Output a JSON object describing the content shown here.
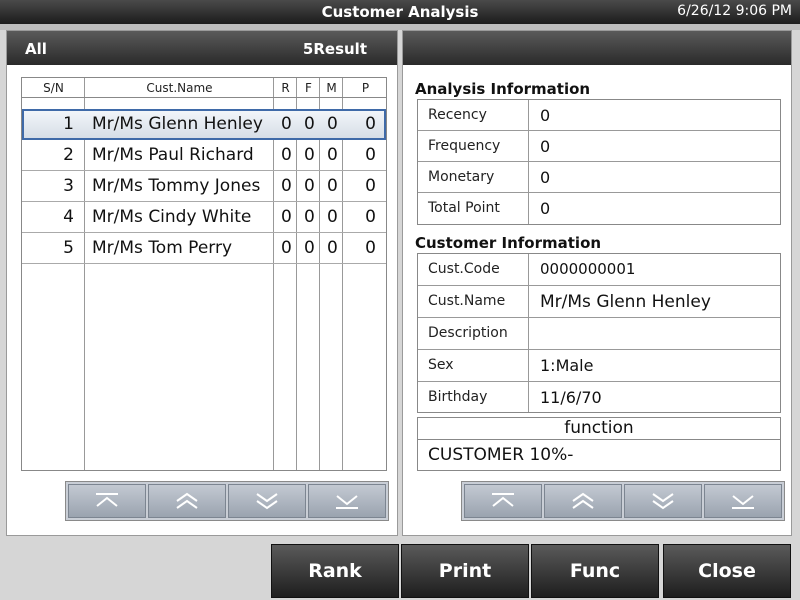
{
  "window": {
    "title": "Customer Analysis",
    "datetime": "6/26/12 9:06 PM"
  },
  "left_panel": {
    "filter_label": "All",
    "result_label": "5Result",
    "columns": [
      "S/N",
      "Cust.Name",
      "R",
      "F",
      "M",
      "P"
    ],
    "rows": [
      {
        "sn": "1",
        "name": "Mr/Ms Glenn Henley",
        "r": "0",
        "f": "0",
        "m": "0",
        "p": "0",
        "selected": true
      },
      {
        "sn": "2",
        "name": "Mr/Ms Paul Richard",
        "r": "0",
        "f": "0",
        "m": "0",
        "p": "0"
      },
      {
        "sn": "3",
        "name": "Mr/Ms Tommy Jones",
        "r": "0",
        "f": "0",
        "m": "0",
        "p": "0"
      },
      {
        "sn": "4",
        "name": "Mr/Ms Cindy White",
        "r": "0",
        "f": "0",
        "m": "0",
        "p": "0"
      },
      {
        "sn": "5",
        "name": "Mr/Ms Tom Perry",
        "r": "0",
        "f": "0",
        "m": "0",
        "p": "0"
      }
    ],
    "pager_icons": [
      "first-page-icon",
      "page-up-icon",
      "page-down-icon",
      "last-page-icon"
    ]
  },
  "right_panel": {
    "analysis_title": "Analysis Information",
    "analysis": [
      {
        "key": "Recency",
        "value": "0"
      },
      {
        "key": "Frequency",
        "value": "0"
      },
      {
        "key": "Monetary",
        "value": "0"
      },
      {
        "key": "Total Point",
        "value": "0"
      }
    ],
    "customer_title": "Customer Information",
    "customer": [
      {
        "key": "Cust.Code",
        "value": "0000000001"
      },
      {
        "key": "Cust.Name",
        "value": "Mr/Ms Glenn Henley"
      },
      {
        "key": "Description",
        "value": ""
      },
      {
        "key": "Sex",
        "value": "1:Male"
      },
      {
        "key": "Birthday",
        "value": "11/6/70"
      }
    ],
    "function_label": "function",
    "function_value": "CUSTOMER 10%-",
    "pager_icons": [
      "first-page-icon",
      "page-up-icon",
      "page-down-icon",
      "last-page-icon"
    ]
  },
  "buttons": {
    "rank": "Rank",
    "print": "Print",
    "func": "Func",
    "close": "Close"
  }
}
